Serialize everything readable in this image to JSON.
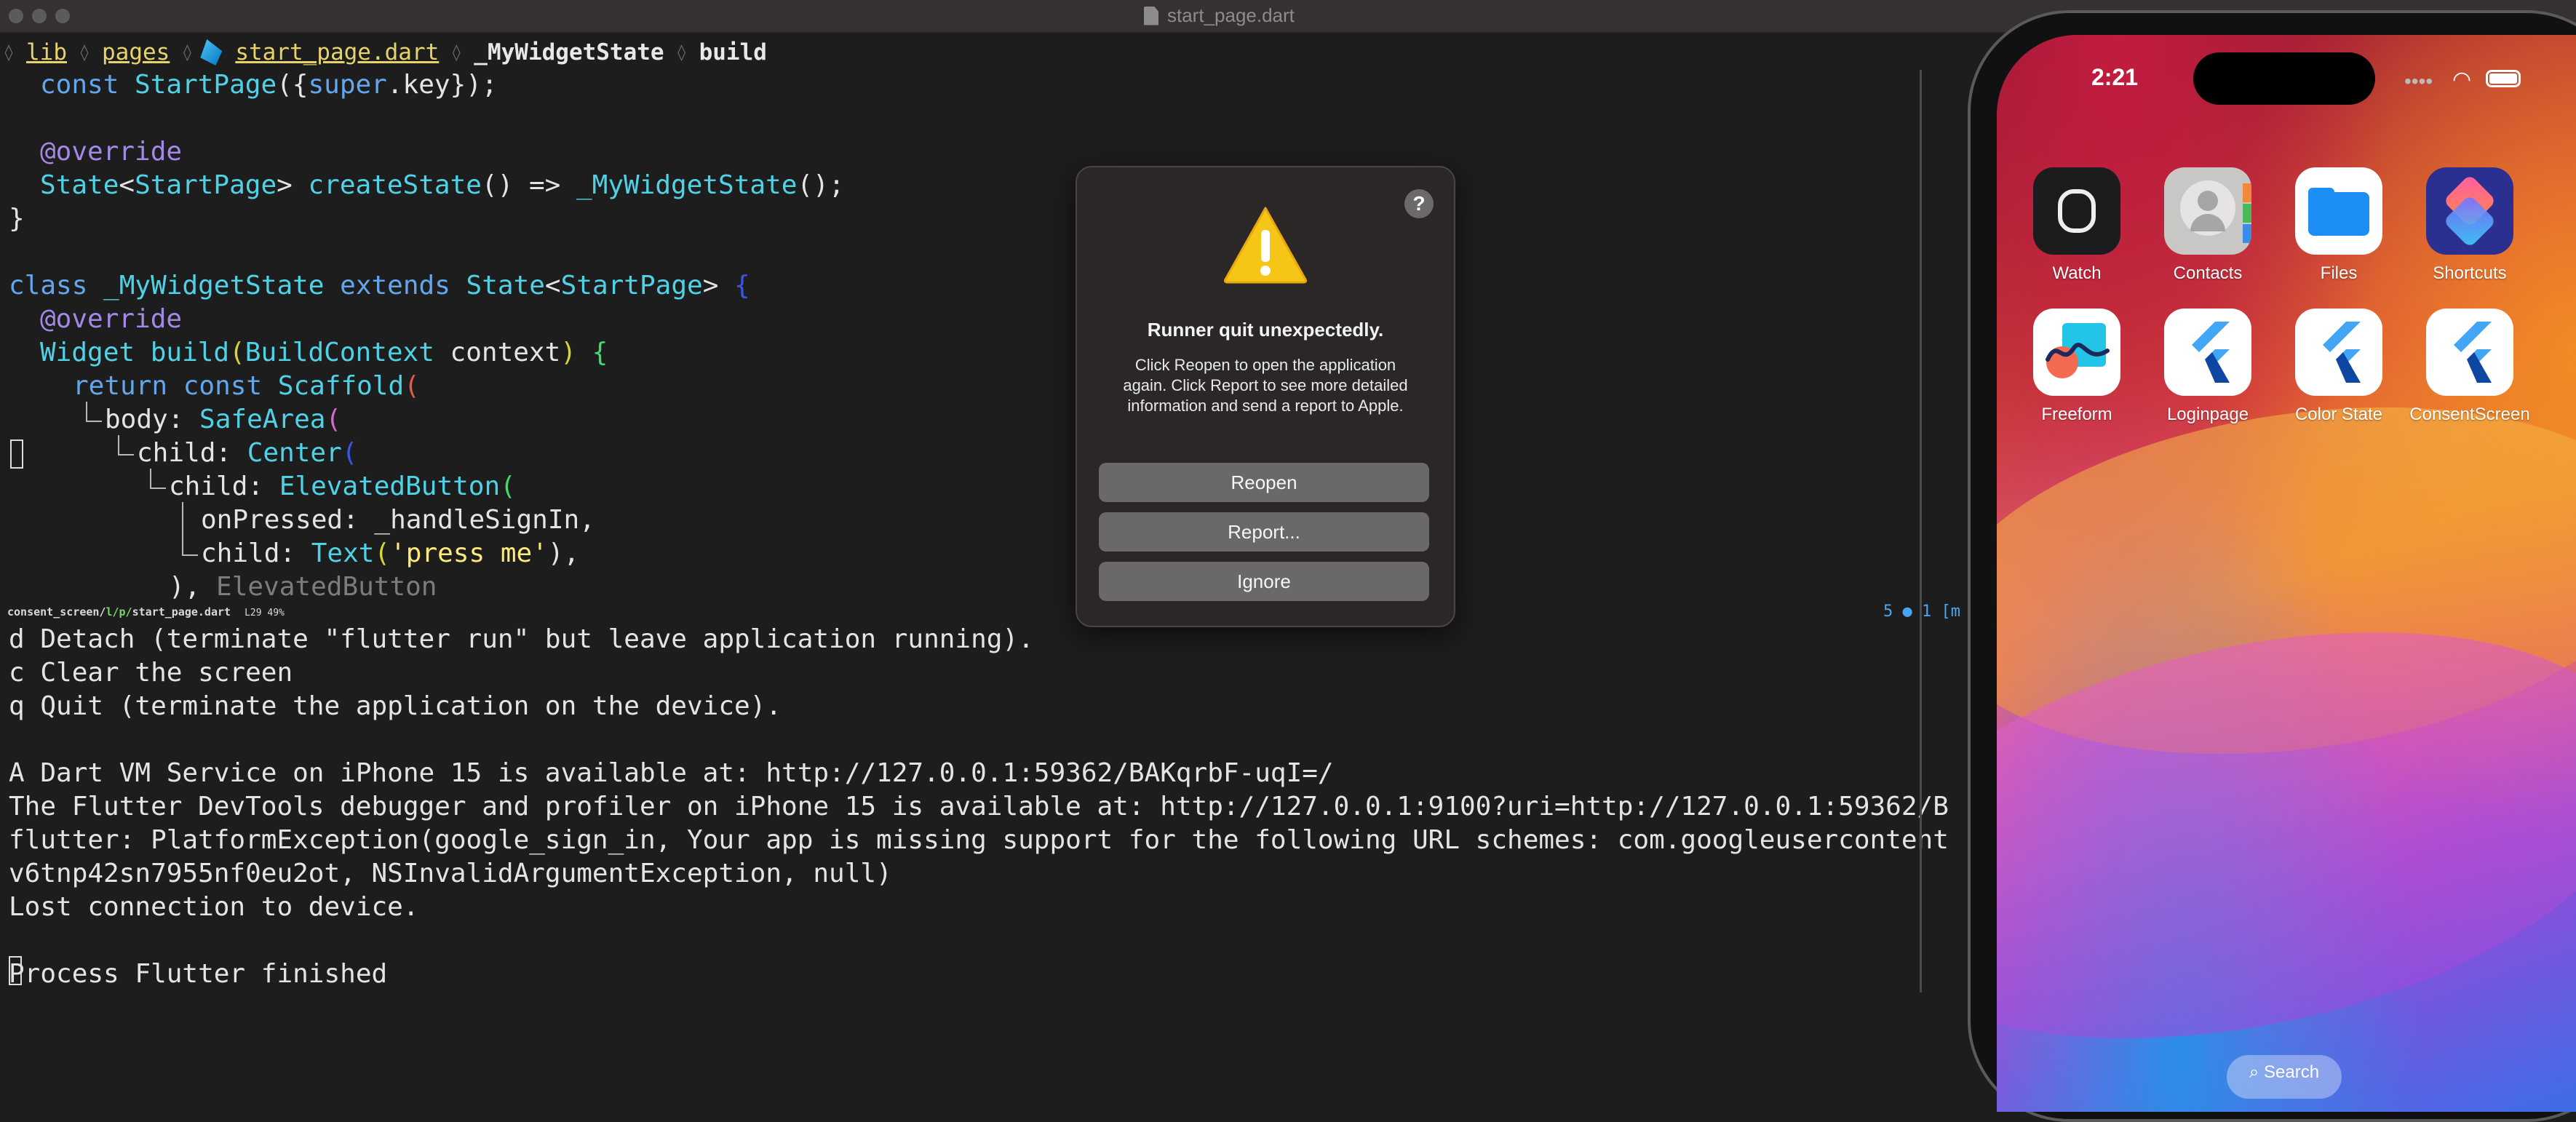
{
  "window": {
    "title": "start_page.dart"
  },
  "breadcrumb": [
    "lib",
    "pages",
    "start_page.dart",
    "_MyWidgetState",
    "build"
  ],
  "code": {
    "line1": [
      "const ",
      "StartPage",
      "({",
      "super",
      ".key});"
    ],
    "line3": "@override",
    "line4": [
      "State",
      "<",
      "StartPage",
      "> ",
      "createState",
      "() => ",
      "_MyWidgetState",
      "();"
    ],
    "line5": "}",
    "line7": [
      "class ",
      "_MyWidgetState ",
      "extends ",
      "State",
      "<",
      "StartPage",
      "> ",
      "{"
    ],
    "line8": "@override",
    "line9": [
      "Widget ",
      "build",
      "(",
      "BuildContext ",
      "context",
      ") ",
      "{"
    ],
    "line10": [
      "return const ",
      "Scaffold",
      "("
    ],
    "line11": [
      "body: ",
      "SafeArea",
      "("
    ],
    "line12": [
      "child: ",
      "Center",
      "("
    ],
    "line13": [
      "child: ",
      "ElevatedButton",
      "("
    ],
    "line14": "onPressed: _handleSignIn,",
    "line15": [
      "child: ",
      "Text",
      "(",
      "'press me'",
      "),"
    ],
    "line16": [
      "),",
      "ElevatedButton"
    ]
  },
  "statusline": {
    "path_prefix": "consent_screen/",
    "path_mid": "l/p/",
    "file": "start_page.dart",
    "pos": "L29 49%",
    "right": "5 ● 1 [m"
  },
  "terminal": [
    "d Detach (terminate \"flutter run\" but leave application running).",
    "c Clear the screen",
    "q Quit (terminate the application on the device).",
    "",
    "A Dart VM Service on iPhone 15 is available at: http://127.0.0.1:59362/BAKqrbF-uqI=/",
    "The Flutter DevTools debugger and profiler on iPhone 15 is available at: http://127.0.0.1:9100?uri=http://127.0.0.1:59362/B",
    "flutter: PlatformException(google_sign_in, Your app is missing support for the following URL schemes: com.googleusercontent",
    "v6tnp42sn7955nf0eu2ot, NSInvalidArgumentException, null)",
    "Lost connection to device.",
    "",
    "Process Flutter finished"
  ],
  "dialog": {
    "help": "?",
    "title": "Runner quit unexpectedly.",
    "message": "Click Reopen to open the application again. Click Report to see more detailed information and send a report to Apple.",
    "buttons": {
      "reopen": "Reopen",
      "report": "Report...",
      "ignore": "Ignore"
    }
  },
  "phone": {
    "time": "2:21",
    "apps_row1": [
      {
        "label": "Watch",
        "icon": "watch-icon",
        "color": "#1c1c1e"
      },
      {
        "label": "Contacts",
        "icon": "contacts-icon",
        "color": "#c9c7c5"
      },
      {
        "label": "Files",
        "icon": "files-icon",
        "color": "#ffffff"
      },
      {
        "label": "Shortcuts",
        "icon": "shortcuts-icon",
        "color": "#2b2f8f"
      }
    ],
    "apps_row2": [
      {
        "label": "Freeform",
        "icon": "freeform-icon",
        "color": "#ffffff"
      },
      {
        "label": "Loginpage",
        "icon": "flutter-icon",
        "color": "#ffffff"
      },
      {
        "label": "Color State",
        "icon": "flutter-icon",
        "color": "#ffffff"
      },
      {
        "label": "ConsentScreen",
        "icon": "flutter-icon",
        "color": "#ffffff"
      }
    ],
    "search": "Search"
  },
  "colors": {
    "warning": "#f5c518",
    "flutter": "#42a5f5",
    "dialog_bg": "#2b2727"
  }
}
